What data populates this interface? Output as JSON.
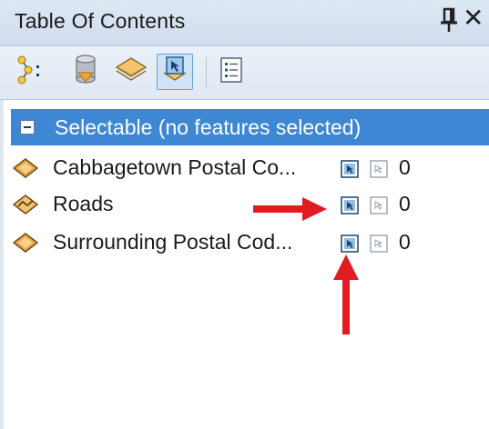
{
  "window": {
    "title": "Table Of Contents",
    "pin_icon": "pin-icon",
    "close_label": "✕"
  },
  "toolbar": {
    "buttons": [
      {
        "name": "list-by-drawing-order",
        "icon": "layers-tree-icon"
      },
      {
        "name": "list-by-source",
        "icon": "database-icon"
      },
      {
        "name": "list-by-visibility",
        "icon": "layer-stack-icon"
      },
      {
        "name": "list-by-selection",
        "icon": "selection-layer-icon",
        "active": true
      },
      {
        "name": "options",
        "icon": "options-list-icon"
      }
    ]
  },
  "group": {
    "label": "Selectable (no features selected)",
    "collapsed": false
  },
  "layers": [
    {
      "name": "Cabbagetown Postal Co...",
      "geometry": "polygon",
      "selectable": true,
      "selected_count": "0"
    },
    {
      "name": "Roads",
      "geometry": "line",
      "selectable": true,
      "selected_count": "0"
    },
    {
      "name": "Surrounding Postal Cod...",
      "geometry": "polygon",
      "selectable": true,
      "selected_count": "0"
    }
  ],
  "annotations": {
    "arrow_color": "#e21b23"
  },
  "colors": {
    "group_header": "#3e87d4",
    "titlebar": "#d6e2f0"
  }
}
